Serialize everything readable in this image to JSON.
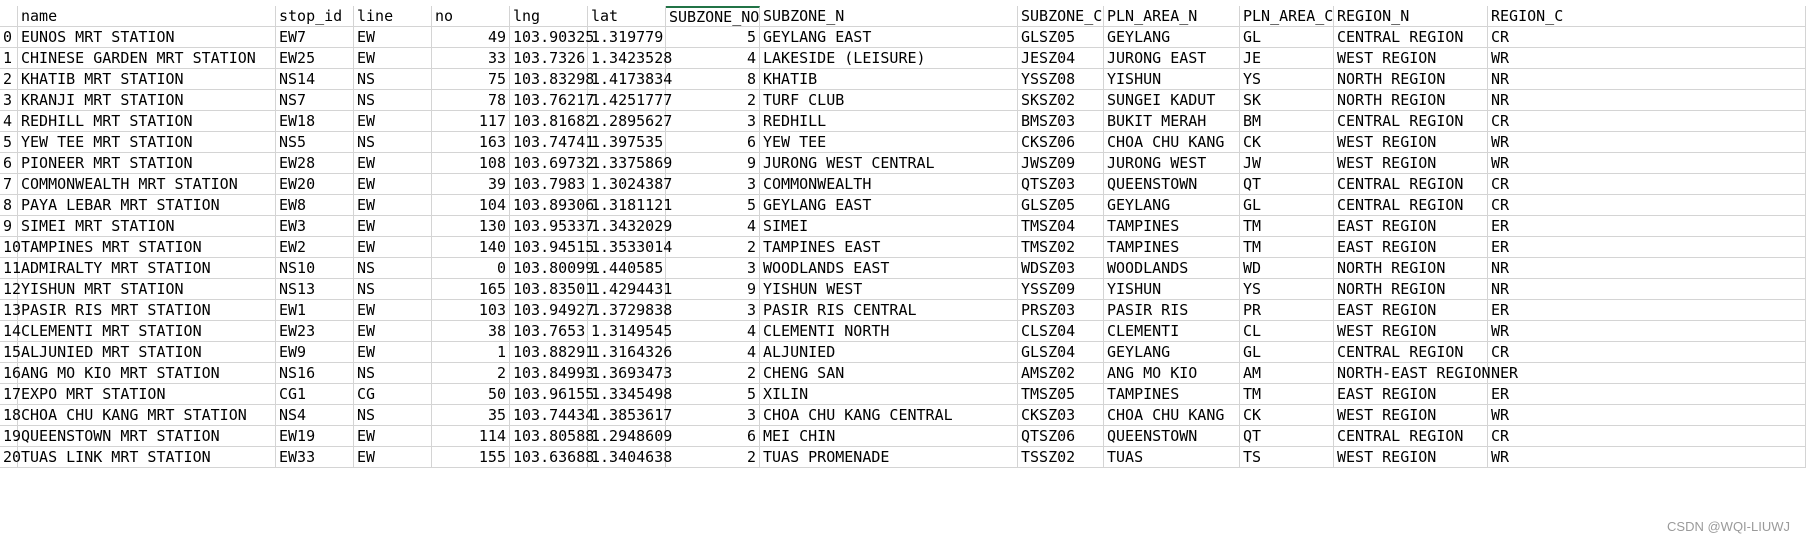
{
  "sheet": {
    "columns": [
      {
        "label": "name",
        "align": "left"
      },
      {
        "label": "stop_id",
        "align": "left"
      },
      {
        "label": "line",
        "align": "left"
      },
      {
        "label": "no",
        "align": "left"
      },
      {
        "label": "lng",
        "align": "left"
      },
      {
        "label": "lat",
        "align": "left"
      },
      {
        "label": "SUBZONE_NO",
        "align": "left"
      },
      {
        "label": "SUBZONE_N",
        "align": "left"
      },
      {
        "label": "SUBZONE_C",
        "align": "left"
      },
      {
        "label": "PLN_AREA_N",
        "align": "left"
      },
      {
        "label": "PLN_AREA_C",
        "align": "left"
      },
      {
        "label": "REGION_N",
        "align": "left"
      },
      {
        "label": "REGION_C",
        "align": "left"
      }
    ],
    "rows": [
      {
        "idx": "0",
        "cells": [
          "EUNOS MRT STATION",
          "EW7",
          "EW",
          "49",
          "103.90325",
          "1.319779",
          "5",
          "GEYLANG EAST",
          "GLSZ05",
          "GEYLANG",
          "GL",
          "CENTRAL REGION",
          "CR"
        ]
      },
      {
        "idx": "1",
        "cells": [
          "CHINESE GARDEN MRT STATION",
          "EW25",
          "EW",
          "33",
          "103.7326",
          "1.3423528",
          "4",
          "LAKESIDE (LEISURE)",
          "JESZ04",
          "JURONG EAST",
          "JE",
          "WEST REGION",
          "WR"
        ]
      },
      {
        "idx": "2",
        "cells": [
          "KHATIB MRT STATION",
          "NS14",
          "NS",
          "75",
          "103.83298",
          "1.4173834",
          "8",
          "KHATIB",
          "YSSZ08",
          "YISHUN",
          "YS",
          "NORTH REGION",
          "NR"
        ]
      },
      {
        "idx": "3",
        "cells": [
          "KRANJI MRT STATION",
          "NS7",
          "NS",
          "78",
          "103.76217",
          "1.4251777",
          "2",
          "TURF CLUB",
          "SKSZ02",
          "SUNGEI KADUT",
          "SK",
          "NORTH REGION",
          "NR"
        ]
      },
      {
        "idx": "4",
        "cells": [
          "REDHILL MRT STATION",
          "EW18",
          "EW",
          "117",
          "103.81682",
          "1.2895627",
          "3",
          "REDHILL",
          "BMSZ03",
          "BUKIT MERAH",
          "BM",
          "CENTRAL REGION",
          "CR"
        ]
      },
      {
        "idx": "5",
        "cells": [
          "YEW TEE MRT STATION",
          "NS5",
          "NS",
          "163",
          "103.74741",
          "1.397535",
          "6",
          "YEW TEE",
          "CKSZ06",
          "CHOA CHU KANG",
          "CK",
          "WEST REGION",
          "WR"
        ]
      },
      {
        "idx": "6",
        "cells": [
          "PIONEER MRT STATION",
          "EW28",
          "EW",
          "108",
          "103.69732",
          "1.3375869",
          "9",
          "JURONG WEST CENTRAL",
          "JWSZ09",
          "JURONG WEST",
          "JW",
          "WEST REGION",
          "WR"
        ]
      },
      {
        "idx": "7",
        "cells": [
          "COMMONWEALTH MRT STATION",
          "EW20",
          "EW",
          "39",
          "103.7983",
          "1.3024387",
          "3",
          "COMMONWEALTH",
          "QTSZ03",
          "QUEENSTOWN",
          "QT",
          "CENTRAL REGION",
          "CR"
        ]
      },
      {
        "idx": "8",
        "cells": [
          "PAYA LEBAR MRT STATION",
          "EW8",
          "EW",
          "104",
          "103.89306",
          "1.3181121",
          "5",
          "GEYLANG EAST",
          "GLSZ05",
          "GEYLANG",
          "GL",
          "CENTRAL REGION",
          "CR"
        ]
      },
      {
        "idx": "9",
        "cells": [
          "SIMEI MRT STATION",
          "EW3",
          "EW",
          "130",
          "103.95337",
          "1.3432029",
          "4",
          "SIMEI",
          "TMSZ04",
          "TAMPINES",
          "TM",
          "EAST REGION",
          "ER"
        ]
      },
      {
        "idx": "10",
        "cells": [
          "TAMPINES MRT STATION",
          "EW2",
          "EW",
          "140",
          "103.94515",
          "1.3533014",
          "2",
          "TAMPINES EAST",
          "TMSZ02",
          "TAMPINES",
          "TM",
          "EAST REGION",
          "ER"
        ]
      },
      {
        "idx": "11",
        "cells": [
          "ADMIRALTY MRT STATION",
          "NS10",
          "NS",
          "0",
          "103.80099",
          "1.440585",
          "3",
          "WOODLANDS EAST",
          "WDSZ03",
          "WOODLANDS",
          "WD",
          "NORTH REGION",
          "NR"
        ]
      },
      {
        "idx": "12",
        "cells": [
          "YISHUN MRT STATION",
          "NS13",
          "NS",
          "165",
          "103.83501",
          "1.4294431",
          "9",
          "YISHUN WEST",
          "YSSZ09",
          "YISHUN",
          "YS",
          "NORTH REGION",
          "NR"
        ]
      },
      {
        "idx": "13",
        "cells": [
          "PASIR RIS MRT STATION",
          "EW1",
          "EW",
          "103",
          "103.94927",
          "1.3729838",
          "3",
          "PASIR RIS CENTRAL",
          "PRSZ03",
          "PASIR RIS",
          "PR",
          "EAST REGION",
          "ER"
        ]
      },
      {
        "idx": "14",
        "cells": [
          "CLEMENTI MRT STATION",
          "EW23",
          "EW",
          "38",
          "103.7653",
          "1.3149545",
          "4",
          "CLEMENTI NORTH",
          "CLSZ04",
          "CLEMENTI",
          "CL",
          "WEST REGION",
          "WR"
        ]
      },
      {
        "idx": "15",
        "cells": [
          "ALJUNIED MRT STATION",
          "EW9",
          "EW",
          "1",
          "103.88291",
          "1.3164326",
          "4",
          "ALJUNIED",
          "GLSZ04",
          "GEYLANG",
          "GL",
          "CENTRAL REGION",
          "CR"
        ]
      },
      {
        "idx": "16",
        "cells": [
          "ANG MO KIO MRT STATION",
          "NS16",
          "NS",
          "2",
          "103.84993",
          "1.3693473",
          "2",
          "CHENG SAN",
          "AMSZ02",
          "ANG MO KIO",
          "AM",
          "NORTH-EAST REGION",
          "NER"
        ]
      },
      {
        "idx": "17",
        "cells": [
          "EXPO MRT STATION",
          "CG1",
          "CG",
          "50",
          "103.96155",
          "1.3345498",
          "5",
          "XILIN",
          "TMSZ05",
          "TAMPINES",
          "TM",
          "EAST REGION",
          "ER"
        ]
      },
      {
        "idx": "18",
        "cells": [
          "CHOA CHU KANG MRT STATION",
          "NS4",
          "NS",
          "35",
          "103.74434",
          "1.3853617",
          "3",
          "CHOA CHU KANG CENTRAL",
          "CKSZ03",
          "CHOA CHU KANG",
          "CK",
          "WEST REGION",
          "WR"
        ]
      },
      {
        "idx": "19",
        "cells": [
          "QUEENSTOWN MRT STATION",
          "EW19",
          "EW",
          "114",
          "103.80588",
          "1.2948609",
          "6",
          "MEI CHIN",
          "QTSZ06",
          "QUEENSTOWN",
          "QT",
          "CENTRAL REGION",
          "CR"
        ]
      },
      {
        "idx": "20",
        "cells": [
          "TUAS LINK MRT STATION",
          "EW33",
          "EW",
          "155",
          "103.63688",
          "1.3404638",
          "2",
          "TUAS PROMENADE",
          "TSSZ02",
          "TUAS",
          "TS",
          "WEST REGION",
          "WR"
        ]
      }
    ],
    "numeric_columns": [
      3,
      4,
      5,
      6
    ],
    "selected_column": 6
  },
  "watermark": "CSDN @WQI-LIUWJ"
}
